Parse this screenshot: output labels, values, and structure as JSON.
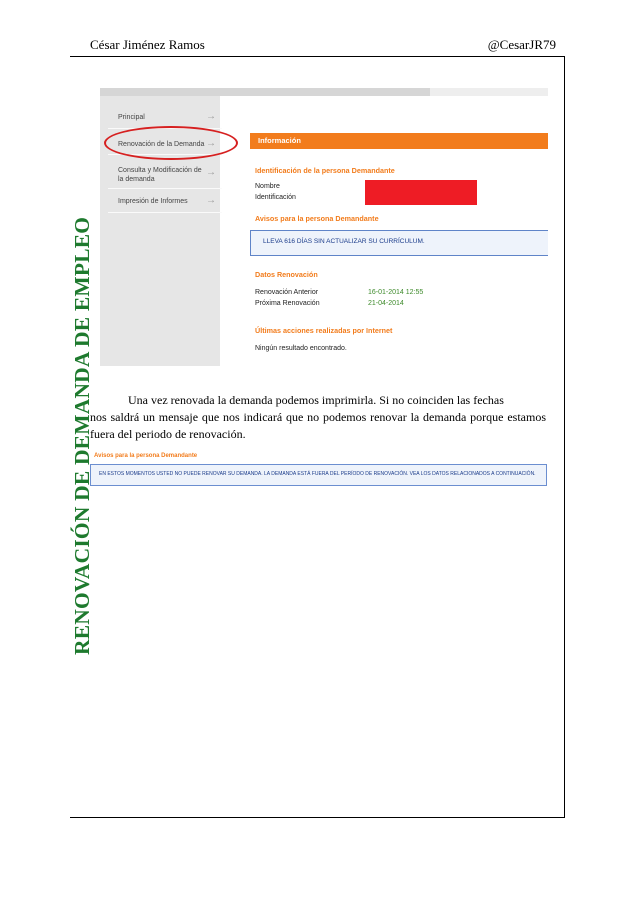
{
  "header": {
    "author": "César Jiménez Ramos",
    "handle": "@CesarJR79"
  },
  "side_title": "RENOVACIÓN DE DEMANDA DE EMPLEO",
  "screenshot1": {
    "menu": [
      {
        "label": "Principal"
      },
      {
        "label": "Renovación de la Demanda"
      },
      {
        "label_line1": "Consulta y Modificación de",
        "label_line2": "la demanda"
      },
      {
        "label": "Impresión de Informes"
      }
    ],
    "info_bar": "Información",
    "ident_heading": "Identificación de la persona Demandante",
    "nombre_label": "Nombre",
    "ident_label": "Identificación",
    "avisos_heading": "Avisos para la persona Demandante",
    "aviso_text": "LLEVA 616 DÍAS SIN ACTUALIZAR SU CURRÍCULUM.",
    "datos_heading": "Datos Renovación",
    "renov_anterior_label": "Renovación Anterior",
    "renov_anterior_value": "16-01-2014 12:55",
    "proxima_label": "Próxima Renovación",
    "proxima_value": "21-04-2014",
    "ultimas_heading": "Últimas acciones realizadas por Internet",
    "ultimas_value": "Ningún resultado encontrado."
  },
  "paragraph": {
    "line1": "Una vez renovada la demanda podemos imprimirla. Si no coinciden las fechas",
    "rest": "nos saldrá un mensaje que nos indicará que no podemos renovar la demanda porque estamos fuera del periodo de renovación."
  },
  "screenshot2": {
    "heading": "Avisos para la persona Demandante",
    "message": "EN ESTOS MOMENTOS USTED NO PUEDE RENOVAR SU DEMANDA. LA DEMANDA ESTÁ FUERA DEL PERÍODO DE RENOVACIÓN. VEA LOS DATOS RELACIONADOS A CONTINUACIÓN."
  },
  "colors": {
    "side_title": "#1e7a2e",
    "orange": "#f27c1c",
    "redacted": "#ee1c25",
    "highlight_circle": "#d62020"
  }
}
